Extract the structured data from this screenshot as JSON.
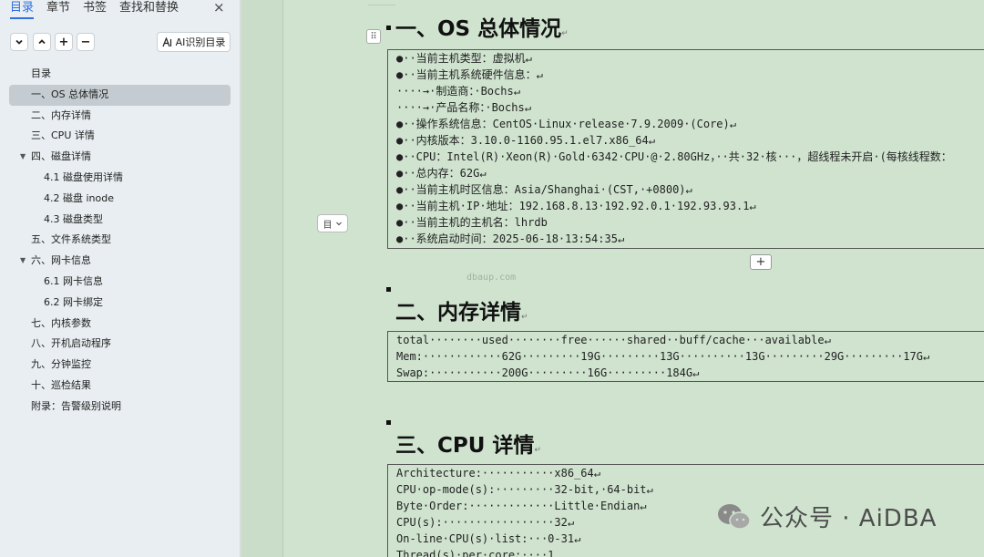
{
  "sidebar": {
    "tabs": [
      "目录",
      "章节",
      "书签",
      "查找和替换"
    ],
    "close_icon": "×",
    "toolbar": {
      "collapse_icon": "⌄",
      "expand_icon": "⌃",
      "add_icon": "+",
      "remove_icon": "−",
      "ai_label": "AI识别目录"
    },
    "toc": [
      {
        "label": "目录",
        "level": 0,
        "arrow": ""
      },
      {
        "label": "一、OS 总体情况",
        "level": 1,
        "arrow": "",
        "selected": true
      },
      {
        "label": "二、内存详情",
        "level": 1,
        "arrow": ""
      },
      {
        "label": "三、CPU 详情",
        "level": 1,
        "arrow": ""
      },
      {
        "label": "四、磁盘详情",
        "level": 1,
        "arrow": "▼"
      },
      {
        "label": "4.1 磁盘使用详情",
        "level": 2,
        "arrow": ""
      },
      {
        "label": "4.2 磁盘 inode",
        "level": 2,
        "arrow": ""
      },
      {
        "label": "4.3 磁盘类型",
        "level": 2,
        "arrow": ""
      },
      {
        "label": "五、文件系统类型",
        "level": 1,
        "arrow": ""
      },
      {
        "label": "六、网卡信息",
        "level": 1,
        "arrow": "▼"
      },
      {
        "label": "6.1 网卡信息",
        "level": 2,
        "arrow": ""
      },
      {
        "label": "6.2 网卡绑定",
        "level": 2,
        "arrow": ""
      },
      {
        "label": "七、内核参数",
        "level": 1,
        "arrow": ""
      },
      {
        "label": "八、开机启动程序",
        "level": 1,
        "arrow": ""
      },
      {
        "label": "九、分钟监控",
        "level": 1,
        "arrow": ""
      },
      {
        "label": "十、巡检结果",
        "level": 1,
        "arrow": ""
      },
      {
        "label": "附录：告警级别说明",
        "level": 1,
        "arrow": ""
      }
    ]
  },
  "document": {
    "return_mark": "↵",
    "sections": [
      {
        "heading": "一、OS 总体情况",
        "lines": [
          "●··当前主机类型：虚拟机↵",
          "●··当前主机系统硬件信息：↵",
          "····→·制造商：·Bochs↵",
          "····→·产品名称：·Bochs↵",
          "●··操作系统信息：CentOS·Linux·release·7.9.2009·(Core)↵",
          "●··内核版本：3.10.0-1160.95.1.el7.x86_64↵",
          "●··CPU：Intel(R)·Xeon(R)·Gold·6342·CPU·@·2.80GHz，··共·32·核···，超线程未开启·(每核线程数：",
          "●··总内存：62G↵",
          "●··当前主机时区信息：Asia/Shanghai·(CST,·+0800)↵",
          "●··当前主机·IP·地址：192.168.8.13·192.92.0.1·192.93.93.1↵",
          "●··当前主机的主机名：lhrdb",
          "●··系统启动时间：2025-06-18·13:54:35↵"
        ]
      },
      {
        "heading": "二、内存详情",
        "lines": [
          "total········used········free······shared··buff/cache···available↵",
          "Mem:············62G·········19G·········13G··········13G·········29G·········17G↵",
          "Swap:···········200G·········16G·········184G↵"
        ]
      },
      {
        "heading": "三、CPU 详情",
        "lines": [
          "Architecture:···········x86_64↵",
          "CPU·op-mode(s):·········32-bit,·64-bit↵",
          "Byte·Order:·············Little·Endian↵",
          "CPU(s):·················32↵",
          "On-line·CPU(s)·list:···0-31↵",
          "Thread(s)·per·core:····1"
        ]
      }
    ],
    "watermark_small": "dbaup.com",
    "add_row_label": "+",
    "drag_icon": "⠿",
    "block_menu_icon": "目"
  },
  "brand_watermark": {
    "text": "公众号 · AiDBA"
  },
  "colors": {
    "accent": "#2f6fe0",
    "document_bg": "#cfe3cf",
    "sidebar_bg": "#e8eef1"
  }
}
